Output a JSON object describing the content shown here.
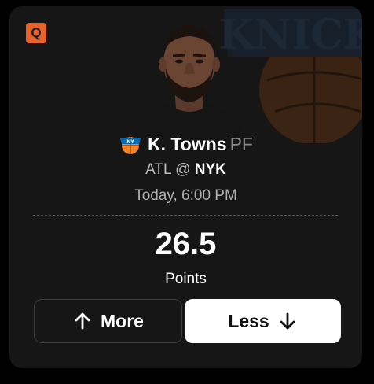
{
  "badge": {
    "label": "Q",
    "color": "#E8632B"
  },
  "player": {
    "name": "K. Towns",
    "position": "PF",
    "team_logo_icon": "knicks-logo-icon",
    "photo": "player-headshot"
  },
  "game": {
    "away": "ATL",
    "separator": "@",
    "home": "NYK",
    "time": "Today, 6:00 PM"
  },
  "projection": {
    "line": "26.5",
    "stat": "Points"
  },
  "actions": {
    "more_label": "More",
    "more_icon": "arrow-up-icon",
    "less_label": "Less",
    "less_icon": "arrow-down-icon"
  },
  "colors": {
    "card_bg": "#161616",
    "knicks_blue": "#006BB6",
    "knicks_orange": "#F58426"
  }
}
